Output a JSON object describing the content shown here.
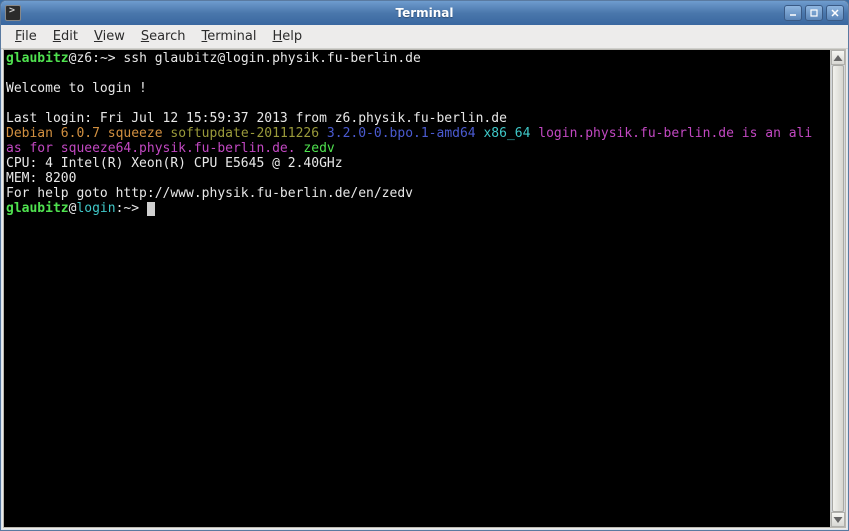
{
  "window": {
    "title": "Terminal"
  },
  "menu": {
    "file": "File",
    "edit": "Edit",
    "view": "View",
    "search": "Search",
    "terminal": "Terminal",
    "help": "Help"
  },
  "prompt1": {
    "user": "glaubitz",
    "at": "@",
    "host": "z6",
    "sep": ":",
    "path": "~",
    "end": "> ",
    "cmd": "ssh glaubitz@login.physik.fu-berlin.de"
  },
  "motd": {
    "welcome": "Welcome to login !",
    "lastlogin": "Last login: Fri Jul 12 15:59:37 2013 from z6.physik.fu-berlin.de",
    "debian": "Debian 6.0.7 squeeze ",
    "softupdate": "softupdate-20111226 ",
    "kernel": "3.2.0-0.bpo.1-amd64 ",
    "arch": "x86_64 ",
    "alias1": "login.physik.fu-berlin.de is an ali",
    "alias2": "as for squeeze64.physik.fu-berlin.de. ",
    "zedv": "zedv",
    "cpu": "CPU: 4 Intel(R) Xeon(R) CPU E5645 @ 2.40GHz",
    "mem": "MEM: 8200",
    "help": "For help goto http://www.physik.fu-berlin.de/en/zedv"
  },
  "prompt2": {
    "user": "glaubitz",
    "at": "@",
    "host": "login",
    "sep": ":",
    "path": "~",
    "end": "> "
  }
}
